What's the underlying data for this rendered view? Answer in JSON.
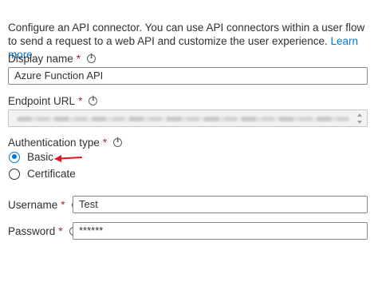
{
  "intro": {
    "text": "Configure an API connector. You can use API connectors within a user flow to send a request to a web API and customize the user experience.",
    "learn_more": "Learn more"
  },
  "display_name": {
    "label": "Display name",
    "required_marker": "*",
    "value": "Azure Function API"
  },
  "endpoint_url": {
    "label": "Endpoint URL",
    "required_marker": "*"
  },
  "auth_type": {
    "label": "Authentication type",
    "required_marker": "*",
    "options": [
      "Basic",
      "Certificate"
    ],
    "selected": "Basic"
  },
  "username": {
    "label": "Username",
    "required_marker": "*",
    "value": "Test"
  },
  "password": {
    "label": "Password",
    "required_marker": "*",
    "value": "******"
  },
  "colors": {
    "accent": "#0078d4",
    "required": "#a4262c",
    "annotation_arrow": "#e81123"
  },
  "icons": [
    "info-icon",
    "scroll-caret-icon",
    "red-arrow-annotation"
  ]
}
